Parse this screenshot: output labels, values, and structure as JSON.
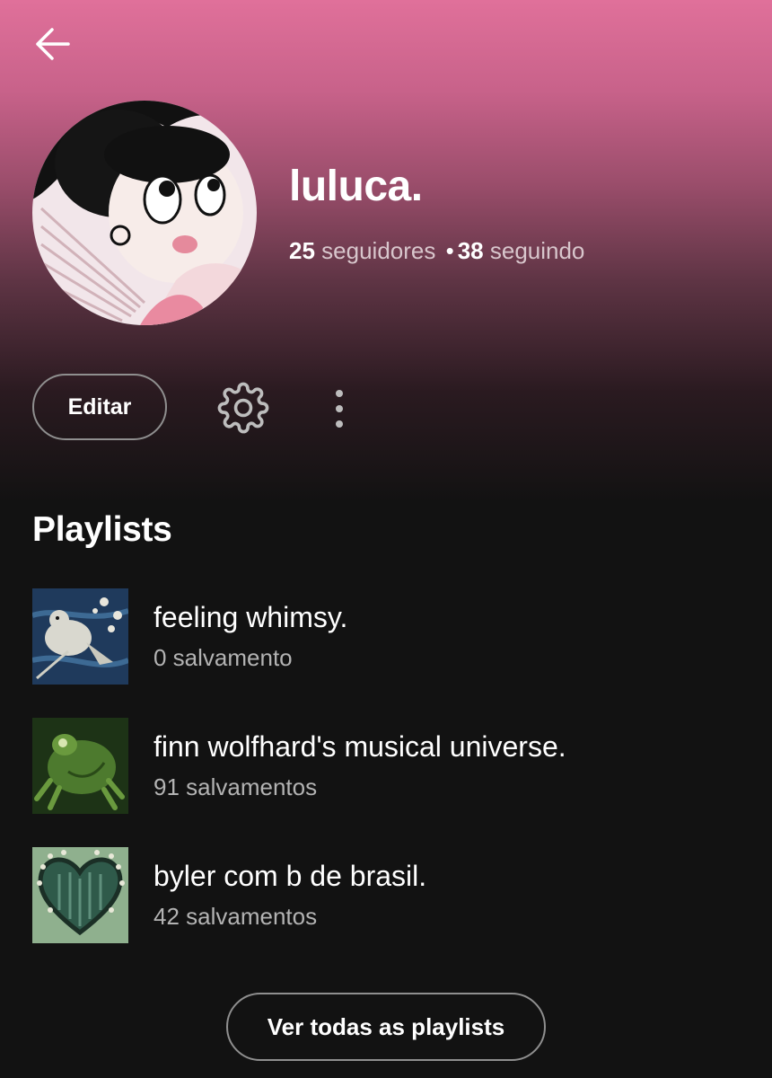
{
  "profile": {
    "username": "luluca.",
    "followers_count": "25",
    "followers_label": "seguidores",
    "separator": "•",
    "following_count": "38",
    "following_label": "seguindo"
  },
  "actions": {
    "edit_label": "Editar",
    "settings_icon": "gear-icon",
    "more_icon": "more-vertical-icon",
    "back_icon": "arrow-left-icon"
  },
  "playlists": {
    "title": "Playlists",
    "items": [
      {
        "name": "feeling whimsy.",
        "saves": "0 salvamento"
      },
      {
        "name": "finn wolfhard's musical universe.",
        "saves": "91 salvamentos"
      },
      {
        "name": "byler com b de brasil.",
        "saves": "42 salvamentos"
      }
    ],
    "see_all_label": "Ver todas as playlists"
  },
  "colors": {
    "header_top": "#e0709a",
    "background": "#121212",
    "secondary_text": "#b3b3b3"
  }
}
